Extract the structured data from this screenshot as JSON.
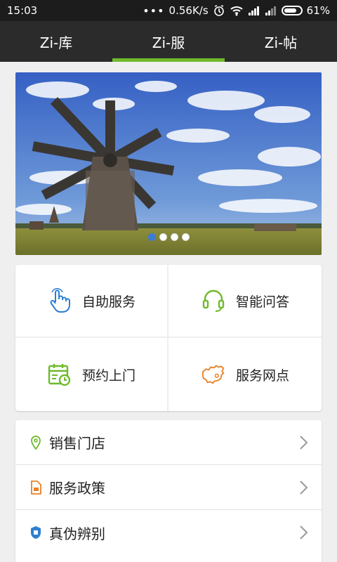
{
  "status": {
    "time": "15:03",
    "speed": "0.56K/s",
    "battery": "61%"
  },
  "tabs": [
    {
      "label": "Zi-库"
    },
    {
      "label": "Zi-服"
    },
    {
      "label": "Zi-帖"
    }
  ],
  "grid": [
    {
      "label": "自助服务",
      "icon": "hand-pointer-icon"
    },
    {
      "label": "智能问答",
      "icon": "headset-icon"
    },
    {
      "label": "预约上门",
      "icon": "calendar-icon"
    },
    {
      "label": "服务网点",
      "icon": "china-map-icon"
    }
  ],
  "list": [
    {
      "label": "销售门店",
      "icon": "location-pin-icon"
    },
    {
      "label": "服务政策",
      "icon": "document-icon"
    },
    {
      "label": "真伪辨别",
      "icon": "shield-icon"
    }
  ],
  "colors": {
    "accent": "#6fba2c",
    "tab_bg": "#2b2b2b",
    "blue": "#2d7fd0",
    "orange": "#e8822a",
    "green": "#6fba2c"
  }
}
